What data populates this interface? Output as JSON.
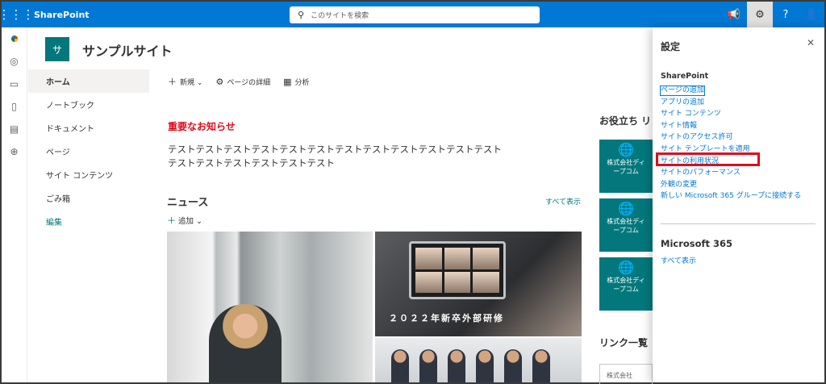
{
  "suitebar": {
    "brand": "SharePoint",
    "search_placeholder": "このサイトを検索",
    "icons": [
      "megaphone-icon",
      "gear-icon",
      "help-icon",
      "person-icon"
    ]
  },
  "site": {
    "icon_letter": "サ",
    "title": "サンプルサイト"
  },
  "nav": [
    "ホーム",
    "ノートブック",
    "ドキュメント",
    "ページ",
    "サイト コンテンツ",
    "ごみ箱",
    "編集"
  ],
  "commands": {
    "new": "新規",
    "page_details": "ページの詳細",
    "analytics": "分析"
  },
  "notice": {
    "heading": "重要なお知らせ",
    "line1": "テストテストテストテストテストテストテストテストテストテストテストテスト",
    "line2": "テストテストテストテストテストテスト"
  },
  "news": {
    "heading": "ニュース",
    "show_all": "すべて表示",
    "add": "追加",
    "caption": "２０２２年新卒外部研修"
  },
  "useful": {
    "heading": "お役立ち リ",
    "tiles": [
      {
        "line1": "株式会社ディ",
        "line2": "ープコム"
      },
      {
        "line1": "株式会社ディ",
        "line2": "ープコム"
      },
      {
        "line1": "株式会社ディ",
        "line2": "ープコム"
      }
    ]
  },
  "links": {
    "heading": "リンク一覧",
    "tile_text": "株式会社"
  },
  "settings": {
    "title": "設定",
    "section_sharepoint": "SharePoint",
    "items": [
      "ページの追加",
      "アプリの追加",
      "サイト コンテンツ",
      "サイト情報",
      "サイトのアクセス許可",
      "サイト テンプレートを適用",
      "サイトの利用状況",
      "サイトのパフォーマンス",
      "外観の変更",
      "新しい Microsoft 365 グループに接続する"
    ],
    "section_m365": "Microsoft 365",
    "m365_show_all": "すべて表示"
  },
  "colors": {
    "suitebar": "#0078d4",
    "theme": "#03787c",
    "highlight": "#e00b1c"
  }
}
